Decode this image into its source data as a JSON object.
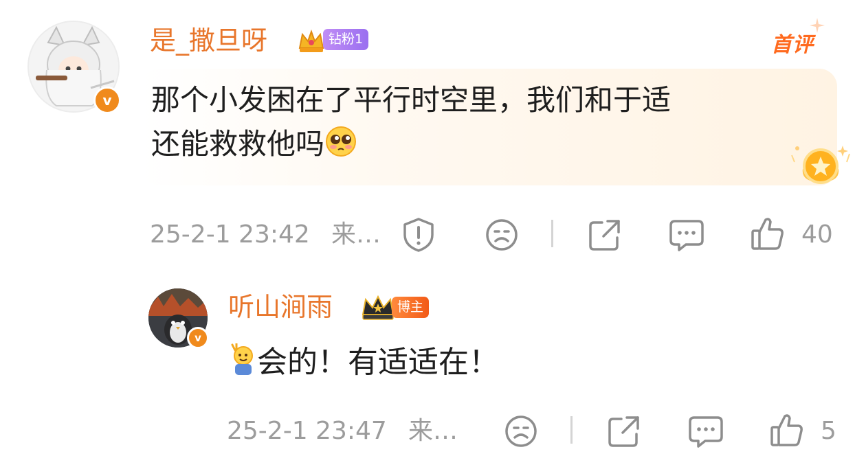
{
  "comments": [
    {
      "username": "是_撒旦呀",
      "fan_tag": "钻粉1",
      "first_label": "首评",
      "text_lines": [
        "那个小发困在了平行时空里，我们和于适",
        "还能救救他吗"
      ],
      "time": "25-2-1 23:42",
      "source": "来…",
      "likes": "40",
      "avatar_badge": "v"
    },
    {
      "username": "听山涧雨",
      "fan_tag": "博主",
      "text": "会的！有适适在！",
      "time": "25-2-1 23:47",
      "source": "来…",
      "likes": "5",
      "avatar_badge": "v"
    }
  ],
  "icons": {
    "report": "report-shield-icon",
    "dislike": "sad-face-icon",
    "share": "share-icon",
    "reply": "comment-bubble-icon",
    "like": "thumbs-up-icon",
    "crown": "crown-icon",
    "emoji_pleading": "pleading-face-emoji",
    "emoji_wave": "waving-hand-emoji",
    "medal": "star-medal-icon"
  },
  "colors": {
    "username": "#e8762b",
    "fan_tag": "#a97af2",
    "blogger_tag": "#f4692a",
    "first_label": "#ff6a1e",
    "meta_text": "#9c9c9c",
    "text": "#1e1e1e"
  }
}
